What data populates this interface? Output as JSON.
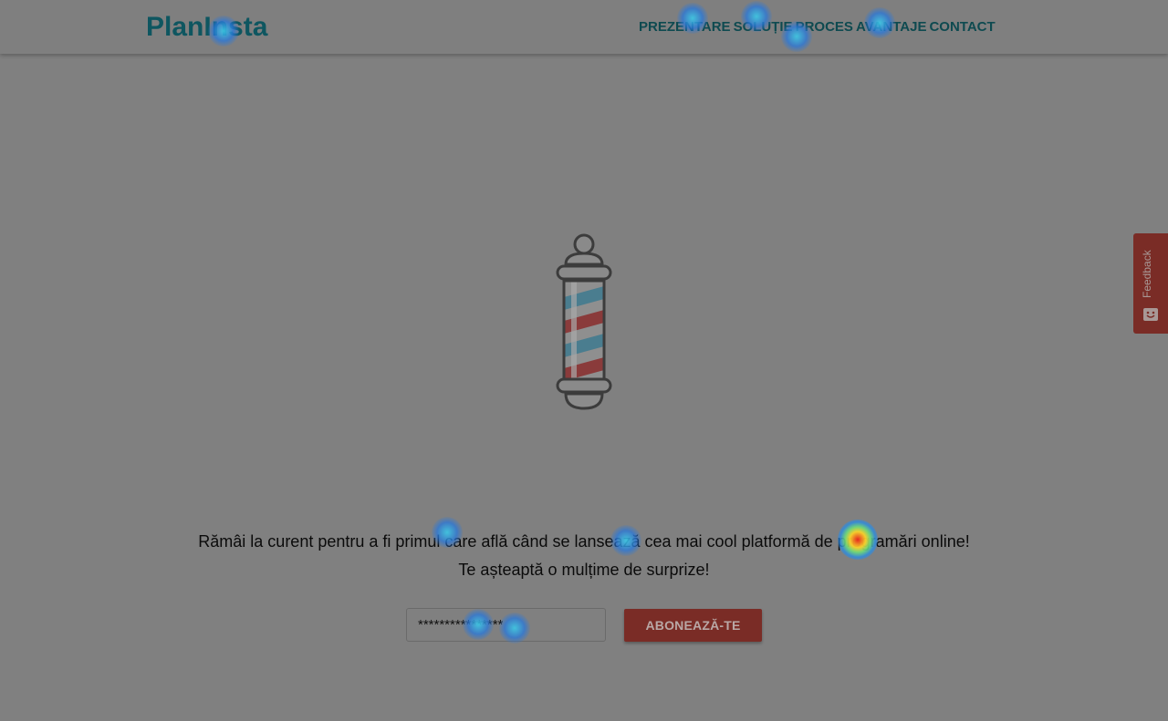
{
  "header": {
    "logo": "PlanInsta",
    "nav": [
      {
        "label": "PREZENTARE"
      },
      {
        "label": "SOLUȚIE"
      },
      {
        "label": "PROCES"
      },
      {
        "label": "AVANTAJE"
      },
      {
        "label": "CONTACT"
      }
    ]
  },
  "hero": {
    "icon": "barber-pole-icon",
    "message_line1": "Rămâi la curent pentru a fi primul care află când se lansează cea mai cool platformă de programări online!",
    "message_line2": "Te așteaptă o mulțime de surprize!"
  },
  "form": {
    "email_value": "****************",
    "subscribe_label": "ABONEAZĂ-TE"
  },
  "feedback": {
    "label": "Feedback",
    "icon": "smile-icon"
  },
  "colors": {
    "brand_teal": "#0e5660",
    "accent_red": "#7a2c26",
    "overlay_gray": "#808080"
  }
}
